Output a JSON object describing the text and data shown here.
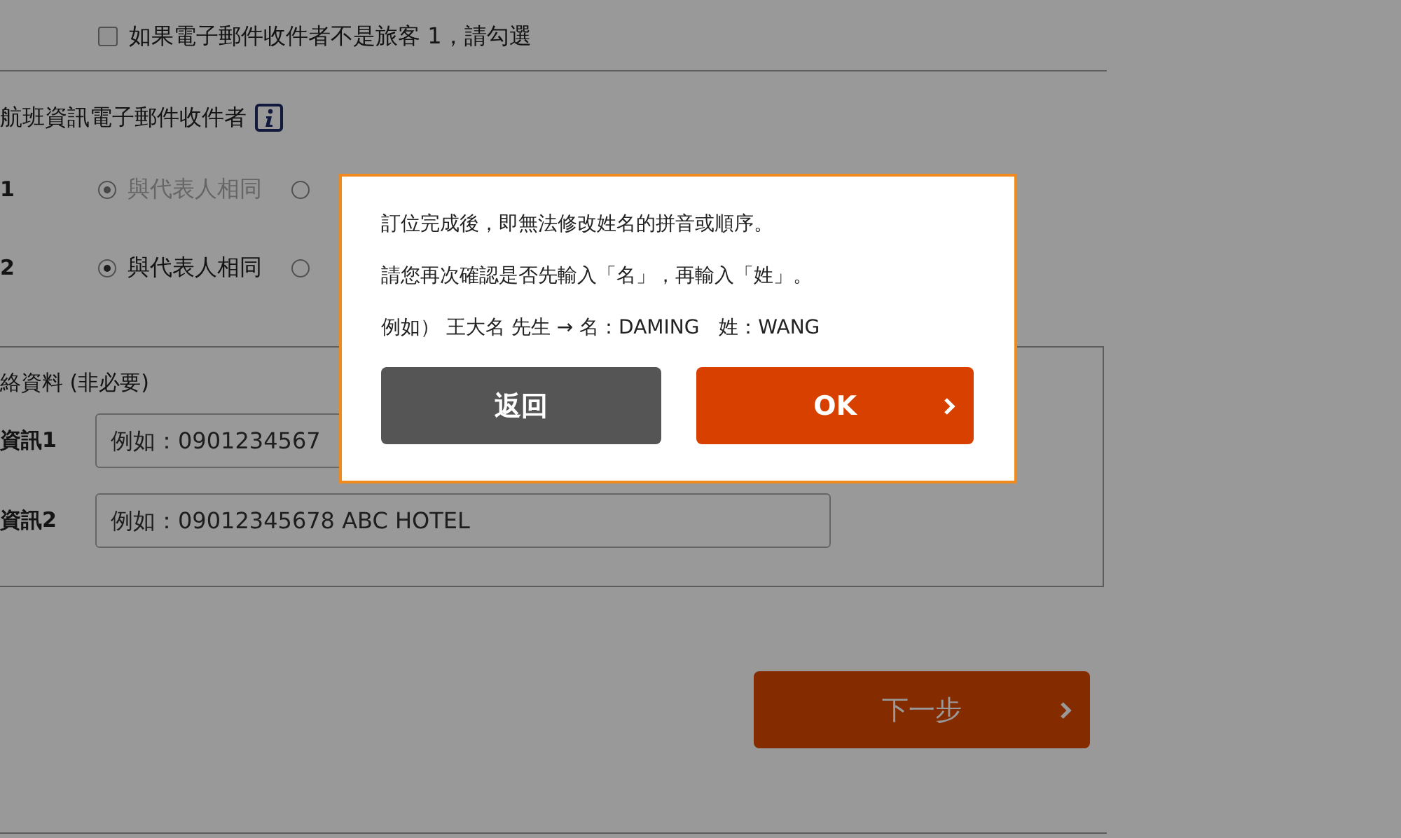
{
  "checkbox": {
    "label": "如果電子郵件收件者不是旅客 1，請勾選",
    "checked": false
  },
  "recipients": {
    "heading": "航班資訊電子郵件收件者",
    "rows": [
      {
        "label": "1",
        "option": "與代表人相同",
        "same_selected": true,
        "other_selected": false,
        "disabled": true
      },
      {
        "label": "2",
        "option": "與代表人相同",
        "same_selected": true,
        "other_selected": false,
        "disabled": false
      }
    ]
  },
  "contact": {
    "heading": "絡資料 (非必要)",
    "fields": [
      {
        "label": "資訊1",
        "placeholder": "例如：0901234567"
      },
      {
        "label": "資訊2",
        "placeholder": "例如：09012345678 ABC HOTEL"
      }
    ]
  },
  "next_button": "下一步",
  "dialog": {
    "lines": [
      "訂位完成後，即無法修改姓名的拼音或順序。",
      "請您再次確認是否先輸入「名」，再輸入「姓」。",
      "例如） 王大名 先生 → 名：DAMING　姓：WANG"
    ],
    "back_button": "返回",
    "ok_button": "OK"
  }
}
